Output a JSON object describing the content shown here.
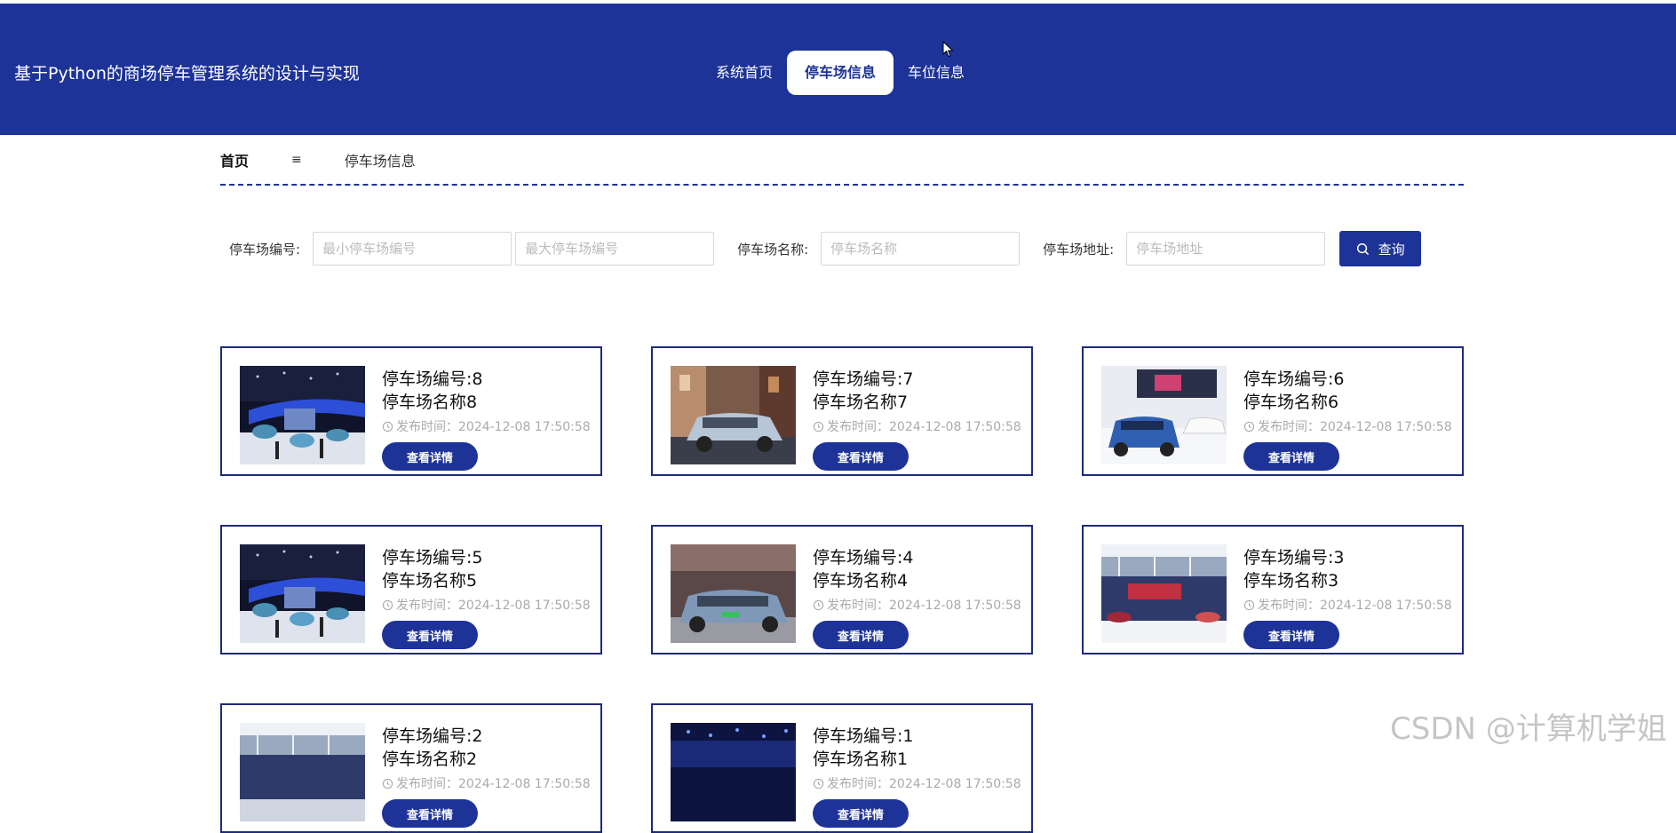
{
  "header": {
    "site_title": "基于Python的商场停车管理系统的设计与实现",
    "nav": [
      "系统首页",
      "停车场信息",
      "车位信息"
    ],
    "active_nav_index": 1
  },
  "breadcrumb": {
    "home": "首页",
    "separator": "≡",
    "current": "停车场信息"
  },
  "search": {
    "parking_no_label": "停车场编号:",
    "min_no_placeholder": "最小停车场编号",
    "max_no_placeholder": "最大停车场编号",
    "name_label": "停车场名称:",
    "name_placeholder": "停车场名称",
    "address_label": "停车场地址:",
    "address_placeholder": "停车场地址",
    "query_button": "查询"
  },
  "cards": [
    {
      "number": "停车场编号:8",
      "name": "停车场名称8",
      "time": "发布时间：2024-12-08 17:50:58",
      "button": "查看详情",
      "image": "auto-show-stage"
    },
    {
      "number": "停车场编号:7",
      "name": "停车场名称7",
      "time": "发布时间：2024-12-08 17:50:58",
      "button": "查看详情",
      "image": "suv-street"
    },
    {
      "number": "停车场编号:6",
      "name": "停车场名称6",
      "time": "发布时间：2024-12-08 17:50:58",
      "button": "查看详情",
      "image": "blue-suv-show"
    },
    {
      "number": "停车场编号:5",
      "name": "停车场名称5",
      "time": "发布时间：2024-12-08 17:50:58",
      "button": "查看详情",
      "image": "auto-show-stage"
    },
    {
      "number": "停车场编号:4",
      "name": "停车场名称4",
      "time": "发布时间：2024-12-08 17:50:58",
      "button": "查看详情",
      "image": "blue-ev-show"
    },
    {
      "number": "停车场编号:3",
      "name": "停车场名称3",
      "time": "发布时间：2024-12-08 17:50:58",
      "button": "查看详情",
      "image": "exhibition-hall"
    },
    {
      "number": "停车场编号:2",
      "name": "停车场名称2",
      "time": "发布时间：2024-12-08 17:50:58",
      "button": "查看详情",
      "image": "exhibition-hall"
    },
    {
      "number": "停车场编号:1",
      "name": "停车场名称1",
      "time": "发布时间：2024-12-08 17:50:58",
      "button": "查看详情",
      "image": "night-stage"
    }
  ],
  "watermark": "CSDN @计算机学姐",
  "colors": {
    "primary": "#1d3397",
    "card_border": "#1e2a7a",
    "muted_text": "#aaaaaa"
  }
}
